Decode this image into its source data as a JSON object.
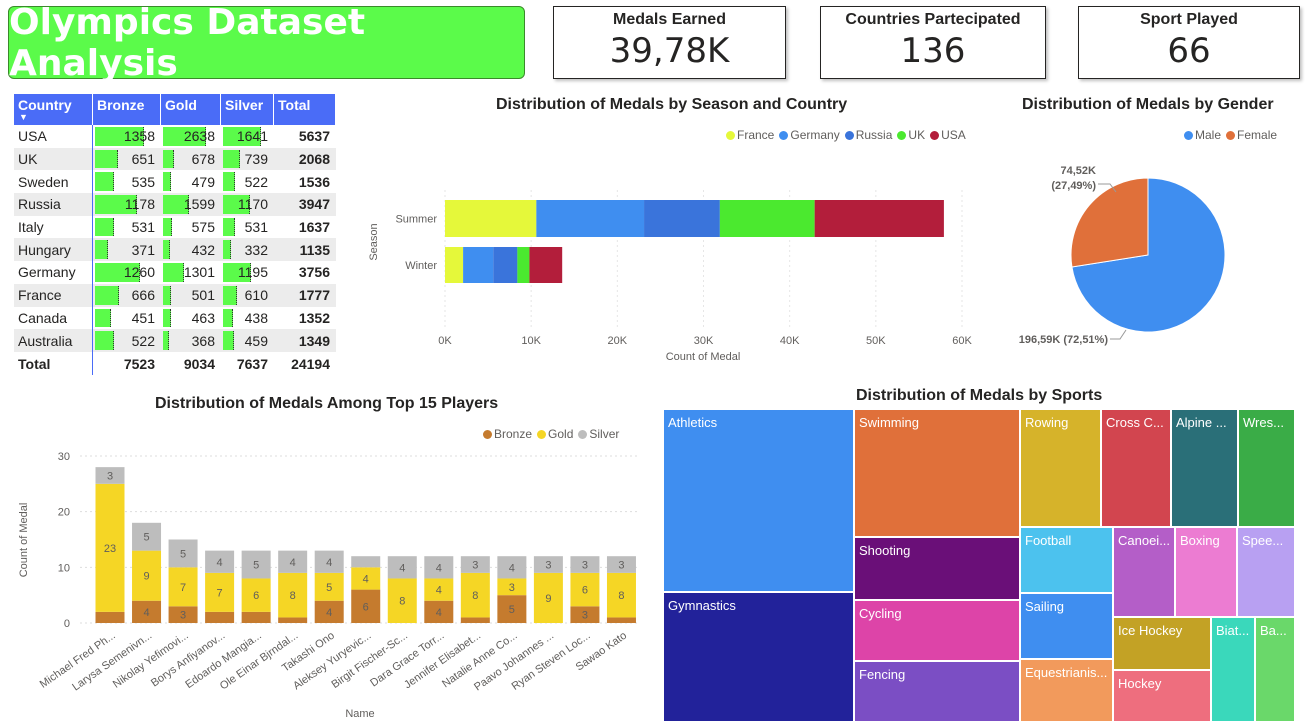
{
  "title": "Olympics Dataset Analysis",
  "kpis": [
    {
      "label": "Medals Earned",
      "value": "39,78K"
    },
    {
      "label": "Countries Partecipated",
      "value": "136"
    },
    {
      "label": "Sport Played",
      "value": "66"
    }
  ],
  "table": {
    "headers": [
      "Country",
      "Bronze",
      "Gold",
      "Silver",
      "Total"
    ],
    "rows": [
      {
        "country": "USA",
        "bronze": 1358,
        "gold": 2638,
        "silver": 1641,
        "total": 5637
      },
      {
        "country": "UK",
        "bronze": 651,
        "gold": 678,
        "silver": 739,
        "total": 2068
      },
      {
        "country": "Sweden",
        "bronze": 535,
        "gold": 479,
        "silver": 522,
        "total": 1536
      },
      {
        "country": "Russia",
        "bronze": 1178,
        "gold": 1599,
        "silver": 1170,
        "total": 3947
      },
      {
        "country": "Italy",
        "bronze": 531,
        "gold": 575,
        "silver": 531,
        "total": 1637
      },
      {
        "country": "Hungary",
        "bronze": 371,
        "gold": 432,
        "silver": 332,
        "total": 1135
      },
      {
        "country": "Germany",
        "bronze": 1260,
        "gold": 1301,
        "silver": 1195,
        "total": 3756
      },
      {
        "country": "France",
        "bronze": 666,
        "gold": 501,
        "silver": 610,
        "total": 1777
      },
      {
        "country": "Canada",
        "bronze": 451,
        "gold": 463,
        "silver": 438,
        "total": 1352
      },
      {
        "country": "Australia",
        "bronze": 522,
        "gold": 368,
        "silver": 459,
        "total": 1349
      }
    ],
    "total": {
      "label": "Total",
      "bronze": "7523",
      "gold": "9034",
      "silver": "7637",
      "total": "24194"
    },
    "bar_color": "#5bfb4a",
    "header_color": "#4a6cf7"
  },
  "chart_data": [
    {
      "type": "bar",
      "orientation": "horizontal",
      "stacked": true,
      "title": "Distribution of Medals by Season and Country",
      "xlabel": "Count of Medal",
      "ylabel": "Season",
      "categories": [
        "Summer",
        "Winter"
      ],
      "xlim": [
        0,
        60000
      ],
      "xticks": [
        "0K",
        "10K",
        "20K",
        "30K",
        "40K",
        "50K",
        "60K"
      ],
      "series": [
        {
          "name": "France",
          "color": "#e5f83a",
          "values": [
            10600,
            2100
          ]
        },
        {
          "name": "Germany",
          "color": "#3f8ef0",
          "values": [
            12500,
            3500
          ]
        },
        {
          "name": "Russia",
          "color": "#3a74db",
          "values": [
            8800,
            2800
          ]
        },
        {
          "name": "UK",
          "color": "#4be92f",
          "values": [
            11000,
            1400
          ]
        },
        {
          "name": "USA",
          "color": "#b31e3b",
          "values": [
            15000,
            3800
          ]
        }
      ]
    },
    {
      "type": "pie",
      "title": "Distribution of Medals by Gender",
      "slices": [
        {
          "name": "Male",
          "value": 196590,
          "label": "196,59K (72,51%)",
          "color": "#3f8ef0"
        },
        {
          "name": "Female",
          "value": 74520,
          "label": "74,52K (27,49%)",
          "color": "#e0703a"
        }
      ],
      "female_label_line1": "74,52K",
      "female_label_line2": "(27,49%)"
    },
    {
      "type": "bar",
      "stacked": true,
      "title": "Distribution of Medals Among Top 15 Players",
      "xlabel": "Name",
      "ylabel": "Count of Medal",
      "ylim": [
        0,
        30
      ],
      "yticks": [
        0,
        10,
        20,
        30
      ],
      "categories": [
        "Michael Fred Ph...",
        "Larysa Semenivn...",
        "Nikolay Yefimovi...",
        "Borys Anfiyanov...",
        "Edoardo Mangia...",
        "Ole Einar Bjrndal...",
        "Takashi Ono",
        "Aleksey Yuryevic...",
        "Birgit Fischer-Sc...",
        "Dara Grace Torr...",
        "Jennifer Elisabet...",
        "Natalie Anne Co...",
        "Paavo Johannes ...",
        "Ryan Steven Loc...",
        "Sawao Kato"
      ],
      "series": [
        {
          "name": "Bronze",
          "color": "#c57b2e",
          "values": [
            2,
            4,
            3,
            2,
            2,
            1,
            4,
            6,
            0,
            4,
            1,
            5,
            0,
            3,
            1
          ]
        },
        {
          "name": "Gold",
          "color": "#f5d625",
          "values": [
            23,
            9,
            7,
            7,
            6,
            8,
            5,
            4,
            8,
            4,
            8,
            3,
            9,
            6,
            8
          ]
        },
        {
          "name": "Silver",
          "color": "#bdbdbd",
          "values": [
            3,
            5,
            5,
            4,
            5,
            4,
            4,
            2,
            4,
            4,
            3,
            4,
            3,
            3,
            3
          ]
        }
      ],
      "labels": [
        {
          "i": 0,
          "series": "Gold",
          "text": "23"
        },
        {
          "i": 0,
          "series": "Silver",
          "text": "3"
        },
        {
          "i": 1,
          "series": "Bronze",
          "text": "4"
        },
        {
          "i": 1,
          "series": "Gold",
          "text": "9"
        },
        {
          "i": 1,
          "series": "Silver",
          "text": "5"
        },
        {
          "i": 2,
          "series": "Bronze",
          "text": "3"
        },
        {
          "i": 2,
          "series": "Gold",
          "text": "7"
        },
        {
          "i": 2,
          "series": "Silver",
          "text": "5"
        },
        {
          "i": 3,
          "series": "Gold",
          "text": "7"
        },
        {
          "i": 3,
          "series": "Silver",
          "text": "4"
        },
        {
          "i": 4,
          "series": "Gold",
          "text": "6"
        },
        {
          "i": 4,
          "series": "Silver",
          "text": "5"
        },
        {
          "i": 5,
          "series": "Gold",
          "text": "8"
        },
        {
          "i": 5,
          "series": "Silver",
          "text": "4"
        },
        {
          "i": 6,
          "series": "Bronze",
          "text": "4"
        },
        {
          "i": 6,
          "series": "Gold",
          "text": "5"
        },
        {
          "i": 6,
          "series": "Silver",
          "text": "4"
        },
        {
          "i": 7,
          "series": "Bronze",
          "text": "6"
        },
        {
          "i": 7,
          "series": "Gold",
          "text": "4"
        },
        {
          "i": 8,
          "series": "Gold",
          "text": "8"
        },
        {
          "i": 8,
          "series": "Silver",
          "text": "4"
        },
        {
          "i": 9,
          "series": "Bronze",
          "text": "4"
        },
        {
          "i": 9,
          "series": "Gold",
          "text": "4"
        },
        {
          "i": 9,
          "series": "Silver",
          "text": "4"
        },
        {
          "i": 10,
          "series": "Gold",
          "text": "8"
        },
        {
          "i": 10,
          "series": "Silver",
          "text": "3"
        },
        {
          "i": 11,
          "series": "Bronze",
          "text": "5"
        },
        {
          "i": 11,
          "series": "Gold",
          "text": "3"
        },
        {
          "i": 11,
          "series": "Silver",
          "text": "4"
        },
        {
          "i": 12,
          "series": "Gold",
          "text": "9"
        },
        {
          "i": 12,
          "series": "Silver",
          "text": "3"
        },
        {
          "i": 13,
          "series": "Bronze",
          "text": "3"
        },
        {
          "i": 13,
          "series": "Gold",
          "text": "6"
        },
        {
          "i": 13,
          "series": "Silver",
          "text": "3"
        },
        {
          "i": 14,
          "series": "Gold",
          "text": "8"
        },
        {
          "i": 14,
          "series": "Silver",
          "text": "3"
        }
      ]
    },
    {
      "type": "treemap",
      "title": "Distribution of Medals by Sports",
      "items": [
        {
          "name": "Athletics",
          "color": "#3f8ef0"
        },
        {
          "name": "Gymnastics",
          "color": "#22229a"
        },
        {
          "name": "Swimming",
          "color": "#e0703a"
        },
        {
          "name": "Shooting",
          "color": "#6a0f78"
        },
        {
          "name": "Cycling",
          "color": "#dd44a8"
        },
        {
          "name": "Fencing",
          "color": "#7b4ec4"
        },
        {
          "name": "Rowing",
          "color": "#d6b32a"
        },
        {
          "name": "Cross C...",
          "color": "#d2454f"
        },
        {
          "name": "Alpine ...",
          "color": "#2a6f78"
        },
        {
          "name": "Wres...",
          "color": "#3aac47"
        },
        {
          "name": "Football",
          "color": "#4cc2ee"
        },
        {
          "name": "Sailing",
          "color": "#3f8ef0"
        },
        {
          "name": "Equestrianis...",
          "color": "#f29a5c"
        },
        {
          "name": "Canoei...",
          "color": "#b45ec8"
        },
        {
          "name": "Boxing",
          "color": "#ec7cd2"
        },
        {
          "name": "Spee...",
          "color": "#b8a0f2"
        },
        {
          "name": "Ice Hockey",
          "color": "#c3a225"
        },
        {
          "name": "Hockey",
          "color": "#ee6e7e"
        },
        {
          "name": "Biat...",
          "color": "#3ad8bb"
        },
        {
          "name": "Ba...",
          "color": "#6ad86a"
        }
      ]
    }
  ]
}
